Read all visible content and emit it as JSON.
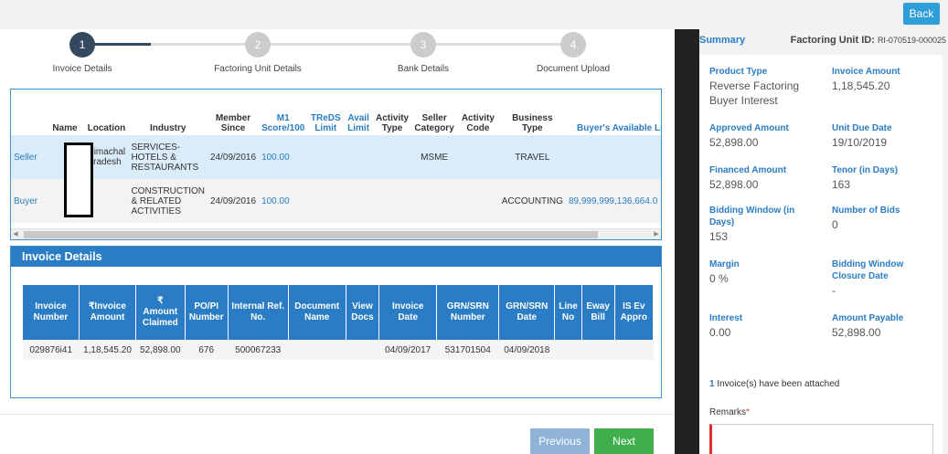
{
  "header": {
    "back_label": "Back"
  },
  "steps": [
    {
      "num": "1",
      "label": "Invoice Details"
    },
    {
      "num": "2",
      "label": "Factoring Unit Details"
    },
    {
      "num": "3",
      "label": "Bank Details"
    },
    {
      "num": "4",
      "label": "Document Upload"
    }
  ],
  "members": {
    "headers": [
      "Name",
      "Location",
      "Industry",
      "Member Since",
      "M1 Score/100",
      "TReDS Limit",
      "Avail Limit",
      "Activity Type",
      "Seller Category",
      "Activity Code",
      "Business Type",
      "Buyer's Available Limit"
    ],
    "seller": {
      "role": "Seller",
      "location": "Himachal Pradesh",
      "industry": "SERVICES-HOTELS & RESTAURANTS",
      "member_since": "24/09/2016",
      "score": "100.00",
      "category": "MSME",
      "business_type": "TRAVEL"
    },
    "buyer": {
      "role": "Buyer",
      "industry": "CONSTRUCTION & RELATED ACTIVITIES",
      "member_since": "24/09/2016",
      "score": "100.00",
      "business_type": "ACCOUNTING",
      "available_limit": "89,999,999,136,664.0"
    }
  },
  "invoice": {
    "title": "Invoice Details",
    "headers": [
      "Invoice Number",
      "₹Invoice Amount",
      "₹ Amount Claimed",
      "PO/PI Number",
      "Internal Ref. No.",
      "Document Name",
      "View Docs",
      "Invoice Date",
      "GRN/SRN Number",
      "GRN/SRN Date",
      "Line No",
      "Eway Bill",
      "IS Ev Appro"
    ],
    "row": [
      "029876i41",
      "1,18,545.20",
      "52,898.00",
      "676",
      "500067233",
      "",
      "",
      "04/09/2017",
      "531701504",
      "04/09/2018",
      "",
      "",
      ""
    ]
  },
  "footer": {
    "previous_label": "Previous",
    "next_label": "Next"
  },
  "summary": {
    "title": "Summary",
    "fu_label": "Factoring Unit ID:",
    "fu_id": "RI-070519-000025",
    "product_type_label": "Product Type",
    "product_type": "Reverse Factoring Buyer Interest",
    "invoice_amount_label": "Invoice Amount",
    "invoice_amount": "1,18,545.20",
    "approved_amount_label": "Approved Amount",
    "approved_amount": "52,898.00",
    "unit_due_date_label": "Unit Due Date",
    "unit_due_date": "19/10/2019",
    "financed_amount_label": "Financed Amount",
    "financed_amount": "52,898.00",
    "tenor_label": "Tenor (in Days)",
    "tenor": "163",
    "bidding_window_label": "Bidding Window (in Days)",
    "bidding_window": "153",
    "num_bids_label": "Number of Bids",
    "num_bids": "0",
    "margin_label": "Margin",
    "margin": "0 %",
    "closure_label": "Bidding Window Closure Date",
    "closure": "-",
    "interest_label": "Interest",
    "interest": "0.00",
    "payable_label": "Amount Payable",
    "payable": "52,898.00",
    "attach_count": "1",
    "attach_text": " Invoice(s) have been attached",
    "remarks_label": "Remarks"
  }
}
